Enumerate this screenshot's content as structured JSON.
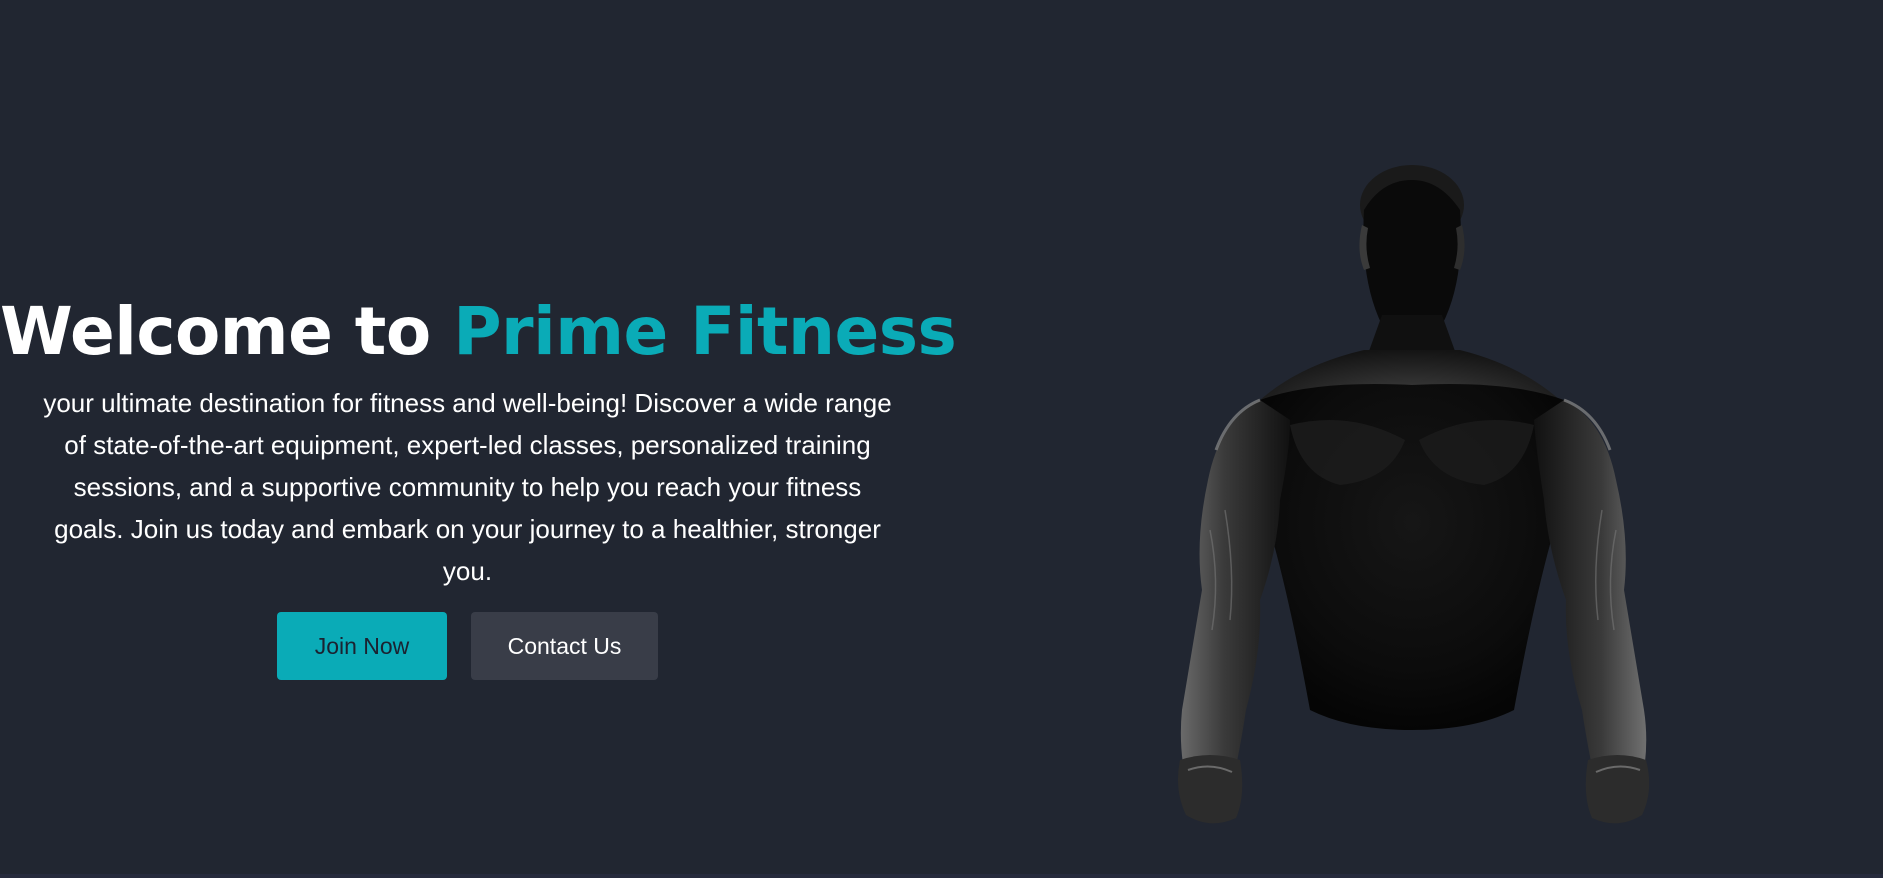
{
  "hero": {
    "title_prefix": "Welcome to ",
    "title_accent": "Prime Fitness",
    "tagline": "your ultimate destination for fitness and well-being! Discover a wide range of state-of-the-art equipment, expert-led classes, personalized training sessions, and a supportive community to help you reach your fitness goals. Join us today and embark on your journey to a healthier, stronger you.",
    "buttons": {
      "join_label": "Join Now",
      "contact_label": "Contact Us"
    },
    "image_subject": "muscular-man-silhouette"
  },
  "colors": {
    "background": "#212631",
    "accent": "#0aabb7",
    "secondary_button": "#393d48",
    "text": "#ffffff"
  }
}
